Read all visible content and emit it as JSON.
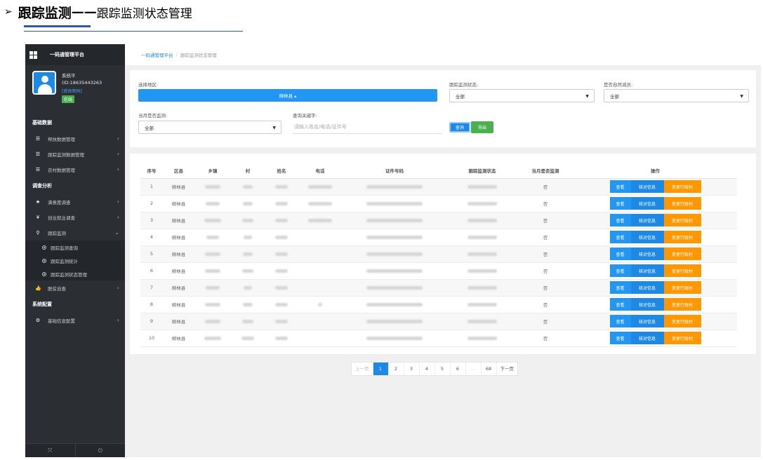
{
  "heading": {
    "arrow": "➢",
    "bold": "跟踪监测",
    "sep": "——",
    "sub": "跟踪监测状态管理"
  },
  "sidebar": {
    "brand": "一码通管理平台",
    "profile": {
      "name": "系统平",
      "phone": "(ID:18635443263",
      "change_pwd": "[修改密码]",
      "status": "在线"
    },
    "sections": [
      {
        "label": "基础数据",
        "items": [
          {
            "label": "帮扶数据管理",
            "icon": "list-icon"
          },
          {
            "label": "跟踪监测数据管理",
            "icon": "list-icon"
          },
          {
            "label": "农村数据管理",
            "icon": "list-icon"
          }
        ]
      },
      {
        "label": "调查分析",
        "items": [
          {
            "label": "满意度调查",
            "icon": "star-icon"
          },
          {
            "label": "创业就业调查",
            "icon": "yen-icon"
          },
          {
            "label": "跟踪监测",
            "icon": "search-icon",
            "expanded": true
          }
        ]
      }
    ],
    "sub_items": [
      "跟踪监测查询",
      "跟踪监测统计",
      "跟踪监测状态管理"
    ],
    "after_items": [
      {
        "label": "脱贫自查",
        "icon": "thumb-icon"
      }
    ],
    "section3": "系统配置",
    "config_items": [
      {
        "label": "基础信息配置",
        "icon": "gear-icon"
      }
    ]
  },
  "breadcrumb": {
    "home": "一码通管理平台",
    "separator": "/",
    "current": "跟踪监测状态管理"
  },
  "filters": {
    "region_label": "选择地区:",
    "region_value": "柳林县 ▴",
    "status_label": "跟踪监测状态:",
    "status_value": "全部",
    "natural_label": "是否自然减员:",
    "natural_value": "全部",
    "month_label": "当月是否监测:",
    "month_value": "全部",
    "keyword_label": "查询关键字:",
    "keyword_placeholder": "请输入姓名/电话/证件号",
    "query_btn": "查询",
    "export_btn": "导出"
  },
  "table": {
    "headers": [
      "序号",
      "区县",
      "乡镇",
      "村",
      "姓名",
      "电话",
      "证件号码",
      "跟踪监测状态",
      "当月是否监测",
      "操作"
    ],
    "rows": [
      {
        "no": "1",
        "county": "柳林县",
        "monitored": "否"
      },
      {
        "no": "2",
        "county": "柳林县",
        "monitored": "否"
      },
      {
        "no": "3",
        "county": "柳林县",
        "monitored": "否"
      },
      {
        "no": "4",
        "county": "柳林县",
        "monitored": "否"
      },
      {
        "no": "5",
        "county": "柳林县",
        "monitored": "否"
      },
      {
        "no": "6",
        "county": "柳林县",
        "monitored": "否"
      },
      {
        "no": "7",
        "county": "柳林县",
        "monitored": "否"
      },
      {
        "no": "8",
        "county": "柳林县",
        "monitored": "否"
      },
      {
        "no": "9",
        "county": "柳林县",
        "monitored": "否"
      },
      {
        "no": "10",
        "county": "柳林县",
        "monitored": "否"
      }
    ],
    "ops": {
      "view": "查看",
      "check": "核对信息",
      "change": "变更行政村"
    }
  },
  "pager": {
    "prev": "上一页",
    "pages": [
      "1",
      "2",
      "3",
      "4",
      "5",
      "6",
      "...",
      "68"
    ],
    "next": "下一页",
    "active": "1"
  },
  "colors": {
    "primary": "#1e88e5",
    "success": "#4caf50",
    "warning": "#ff9800",
    "sidebar": "#2b2e33"
  }
}
